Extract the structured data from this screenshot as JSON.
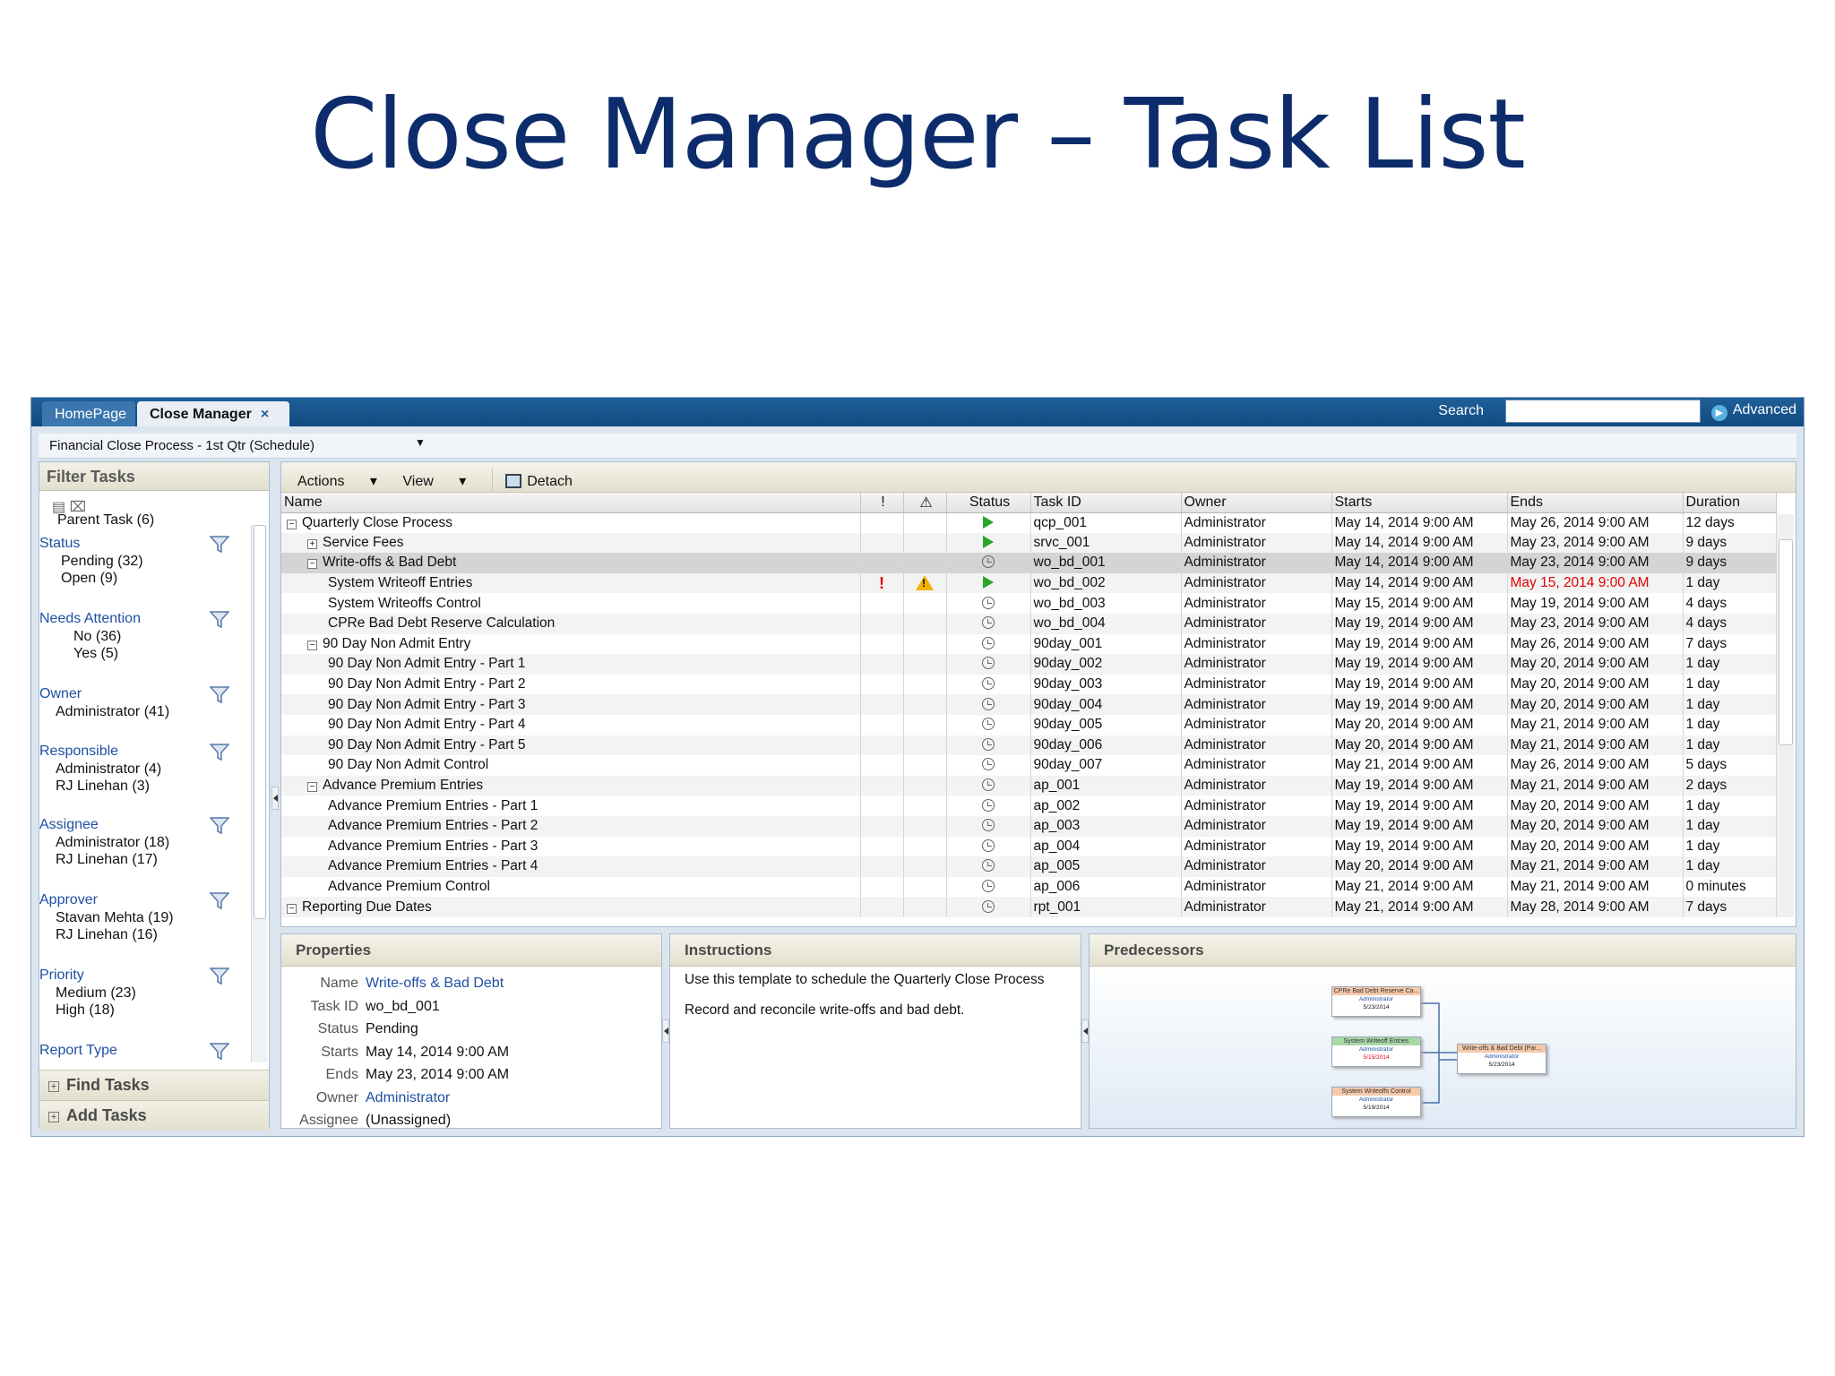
{
  "slide_title": "Close Manager – Task List",
  "tabs": {
    "home": "HomePage",
    "close_manager": "Close Manager",
    "close_x": "×"
  },
  "search": {
    "label": "Search",
    "value": "",
    "advanced": "Advanced"
  },
  "process_select": "Financial Close Process - 1st Qtr (Schedule)",
  "filter": {
    "title": "Filter Tasks",
    "parent_task": "Parent Task (6)",
    "groups": [
      {
        "heading": "Status",
        "items": [
          "Pending (32)",
          "Open (9)"
        ]
      },
      {
        "heading": "Needs Attention",
        "items": [
          "No (36)",
          "Yes (5)"
        ]
      },
      {
        "heading": "Owner",
        "items": [
          "Administrator (41)"
        ]
      },
      {
        "heading": "Responsible",
        "items": [
          "Administrator (4)",
          "RJ Linehan (3)"
        ]
      },
      {
        "heading": "Assignee",
        "items": [
          "Administrator (18)",
          "RJ Linehan (17)"
        ]
      },
      {
        "heading": "Approver",
        "items": [
          "Stavan Mehta (19)",
          "RJ Linehan (16)"
        ]
      },
      {
        "heading": "Priority",
        "items": [
          "Medium (23)",
          "High (18)"
        ]
      },
      {
        "heading": "Report Type",
        "items": []
      }
    ],
    "find_tasks": "Find Tasks",
    "add_tasks": "Add Tasks"
  },
  "toolbar": {
    "actions": "Actions",
    "view": "View",
    "detach": "Detach"
  },
  "columns": {
    "name": "Name",
    "status": "Status",
    "task_id": "Task ID",
    "owner": "Owner",
    "starts": "Starts",
    "ends": "Ends",
    "duration": "Duration"
  },
  "tasks": [
    {
      "level": 0,
      "toggle": "⊟",
      "name": "Quarterly Close Process",
      "status": "running",
      "id": "qcp_001",
      "owner": "Administrator",
      "starts": "May 14, 2014 9:00 AM",
      "ends": "May 26, 2014 9:00 AM",
      "duration": "12 days"
    },
    {
      "level": 1,
      "toggle": "⊞",
      "name": "Service Fees",
      "status": "running",
      "id": "srvc_001",
      "owner": "Administrator",
      "starts": "May 14, 2014 9:00 AM",
      "ends": "May 23, 2014 9:00 AM",
      "duration": "9 days"
    },
    {
      "level": 1,
      "toggle": "⊟",
      "name": "Write-offs & Bad Debt",
      "status": "pending",
      "id": "wo_bd_001",
      "owner": "Administrator",
      "starts": "May 14, 2014 9:00 AM",
      "ends": "May 23, 2014 9:00 AM",
      "duration": "9 days",
      "selected": true
    },
    {
      "level": 2,
      "name": "System Writeoff Entries",
      "status": "running",
      "id": "wo_bd_002",
      "owner": "Administrator",
      "starts": "May 14, 2014 9:00 AM",
      "ends": "May 15, 2014 9:00 AM",
      "duration": "1 day",
      "priority": "!",
      "alert": true,
      "late": true
    },
    {
      "level": 2,
      "name": "System Writeoffs Control",
      "status": "pending",
      "id": "wo_bd_003",
      "owner": "Administrator",
      "starts": "May 15, 2014 9:00 AM",
      "ends": "May 19, 2014 9:00 AM",
      "duration": "4 days"
    },
    {
      "level": 2,
      "name": "CPRe Bad Debt Reserve Calculation",
      "status": "pending",
      "id": "wo_bd_004",
      "owner": "Administrator",
      "starts": "May 19, 2014 9:00 AM",
      "ends": "May 23, 2014 9:00 AM",
      "duration": "4 days"
    },
    {
      "level": 1,
      "toggle": "⊟",
      "name": "90 Day Non Admit Entry",
      "status": "pending",
      "id": "90day_001",
      "owner": "Administrator",
      "starts": "May 19, 2014 9:00 AM",
      "ends": "May 26, 2014 9:00 AM",
      "duration": "7 days"
    },
    {
      "level": 2,
      "name": "90 Day Non Admit Entry - Part 1",
      "status": "pending",
      "id": "90day_002",
      "owner": "Administrator",
      "starts": "May 19, 2014 9:00 AM",
      "ends": "May 20, 2014 9:00 AM",
      "duration": "1 day"
    },
    {
      "level": 2,
      "name": "90 Day Non Admit Entry - Part 2",
      "status": "pending",
      "id": "90day_003",
      "owner": "Administrator",
      "starts": "May 19, 2014 9:00 AM",
      "ends": "May 20, 2014 9:00 AM",
      "duration": "1 day"
    },
    {
      "level": 2,
      "name": "90 Day Non Admit Entry - Part 3",
      "status": "pending",
      "id": "90day_004",
      "owner": "Administrator",
      "starts": "May 19, 2014 9:00 AM",
      "ends": "May 20, 2014 9:00 AM",
      "duration": "1 day"
    },
    {
      "level": 2,
      "name": "90 Day Non Admit Entry - Part 4",
      "status": "pending",
      "id": "90day_005",
      "owner": "Administrator",
      "starts": "May 20, 2014 9:00 AM",
      "ends": "May 21, 2014 9:00 AM",
      "duration": "1 day"
    },
    {
      "level": 2,
      "name": "90 Day Non Admit Entry - Part 5",
      "status": "pending",
      "id": "90day_006",
      "owner": "Administrator",
      "starts": "May 20, 2014 9:00 AM",
      "ends": "May 21, 2014 9:00 AM",
      "duration": "1 day"
    },
    {
      "level": 2,
      "name": "90 Day Non Admit Control",
      "status": "pending",
      "id": "90day_007",
      "owner": "Administrator",
      "starts": "May 21, 2014 9:00 AM",
      "ends": "May 26, 2014 9:00 AM",
      "duration": "5 days"
    },
    {
      "level": 1,
      "toggle": "⊟",
      "name": "Advance Premium Entries",
      "status": "pending",
      "id": "ap_001",
      "owner": "Administrator",
      "starts": "May 19, 2014 9:00 AM",
      "ends": "May 21, 2014 9:00 AM",
      "duration": "2 days"
    },
    {
      "level": 2,
      "name": "Advance Premium Entries - Part 1",
      "status": "pending",
      "id": "ap_002",
      "owner": "Administrator",
      "starts": "May 19, 2014 9:00 AM",
      "ends": "May 20, 2014 9:00 AM",
      "duration": "1 day"
    },
    {
      "level": 2,
      "name": "Advance Premium Entries - Part 2",
      "status": "pending",
      "id": "ap_003",
      "owner": "Administrator",
      "starts": "May 19, 2014 9:00 AM",
      "ends": "May 20, 2014 9:00 AM",
      "duration": "1 day"
    },
    {
      "level": 2,
      "name": "Advance Premium Entries - Part 3",
      "status": "pending",
      "id": "ap_004",
      "owner": "Administrator",
      "starts": "May 19, 2014 9:00 AM",
      "ends": "May 20, 2014 9:00 AM",
      "duration": "1 day"
    },
    {
      "level": 2,
      "name": "Advance Premium Entries - Part 4",
      "status": "pending",
      "id": "ap_005",
      "owner": "Administrator",
      "starts": "May 20, 2014 9:00 AM",
      "ends": "May 21, 2014 9:00 AM",
      "duration": "1 day"
    },
    {
      "level": 2,
      "name": "Advance Premium Control",
      "status": "pending",
      "id": "ap_006",
      "owner": "Administrator",
      "starts": "May 21, 2014 9:00 AM",
      "ends": "May 21, 2014 9:00 AM",
      "duration": "0 minutes"
    },
    {
      "level": 0,
      "toggle": "⊟",
      "name": "Reporting Due Dates",
      "status": "pending",
      "id": "rpt_001",
      "owner": "Administrator",
      "starts": "May 21, 2014 9:00 AM",
      "ends": "May 28, 2014 9:00 AM",
      "duration": "7 days"
    }
  ],
  "properties": {
    "title": "Properties",
    "rows": [
      {
        "key": "Name",
        "value": "Write-offs & Bad Debt",
        "link": true
      },
      {
        "key": "Task ID",
        "value": "wo_bd_001"
      },
      {
        "key": "Status",
        "value": "Pending"
      },
      {
        "key": "Starts",
        "value": "May 14, 2014 9:00 AM"
      },
      {
        "key": "Ends",
        "value": "May 23, 2014 9:00 AM"
      },
      {
        "key": "Owner",
        "value": "Administrator",
        "link": true
      },
      {
        "key": "Assignee",
        "value": "(Unassigned)"
      }
    ]
  },
  "instructions": {
    "title": "Instructions",
    "lines": [
      "Use this template to schedule the Quarterly Close Process",
      "Record and reconcile write-offs and bad debt."
    ]
  },
  "predecessors": {
    "title": "Predecessors",
    "nodes": [
      {
        "title": "CPRe Bad Debt Reserve Ca...",
        "owner": "Administrator",
        "date": "5/23/2014"
      },
      {
        "title": "System Writeoff Entries",
        "owner": "Administrator",
        "date": "5/15/2014"
      },
      {
        "title": "System Writeoffs Control",
        "owner": "Administrator",
        "date": "5/19/2014"
      },
      {
        "title": "Write-offs & Bad Debt (Par...",
        "owner": "Administrator",
        "date": "5/23/2014"
      }
    ]
  },
  "colors": {
    "title": "#0d2c6b",
    "topbar": "#124a80",
    "link": "#1f4fa3",
    "late": "#e00000",
    "running": "#2aa52a",
    "warning": "#f2b300"
  }
}
